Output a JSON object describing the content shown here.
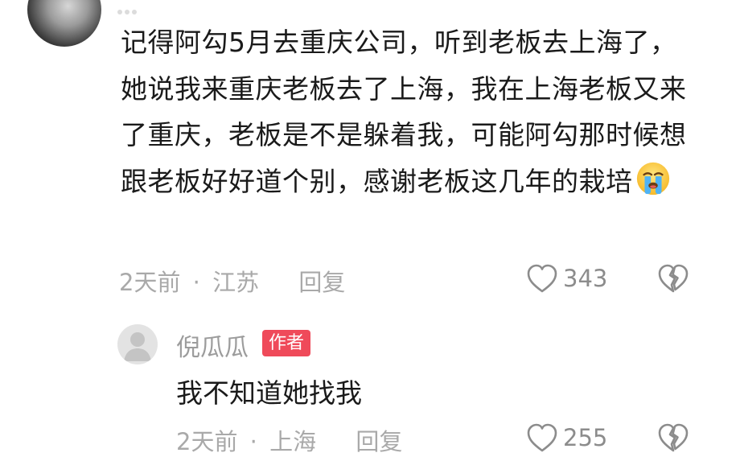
{
  "comment": {
    "text": "记得阿勾5月去重庆公司，听到老板去上海了，她说我来重庆老板去了上海，我在上海老板又来了重庆，老板是不是躲着我，可能阿勾那时候想跟老板好好道个别，感谢老板这几年的栽培",
    "emoji": "crying-face",
    "time": "2天前",
    "separator": "·",
    "location": "江苏",
    "reply_label": "回复",
    "likes": "343"
  },
  "reply": {
    "author": "倪瓜瓜",
    "badge": "作者",
    "text": "我不知道她找我",
    "time": "2天前",
    "separator": "·",
    "location": "上海",
    "reply_label": "回复",
    "likes": "255"
  },
  "colors": {
    "meta_gray": "#a9a9a9",
    "badge_red": "#ef4a5a",
    "text": "#1a1a1a"
  }
}
